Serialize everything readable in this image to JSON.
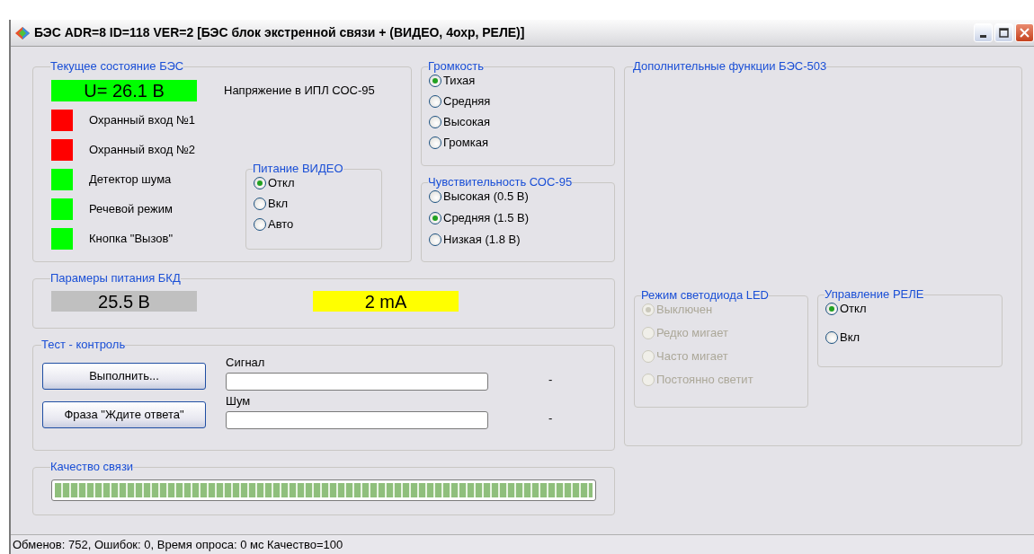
{
  "window": {
    "title": "БЭС ADR=8 ID=118 VER=2 [БЭС блок экстренной связи + (ВИДЕО, 4охр, РЕЛЕ)]"
  },
  "current_state": {
    "title": "Текущее состояние БЭС",
    "voltage": {
      "text": "U= 26.1 В",
      "color": "#00ff00"
    },
    "voltage_label": "Напряжение в ИПЛ СОС-95",
    "indicators": [
      {
        "label": "Охранный вход №1",
        "color": "#ff0000"
      },
      {
        "label": "Охранный вход №2",
        "color": "#ff0000"
      },
      {
        "label": "Детектор шума",
        "color": "#00ff00"
      },
      {
        "label": "Речевой режим",
        "color": "#00ff00"
      },
      {
        "label": "Кнопка \"Вызов\"",
        "color": "#00ff00"
      }
    ]
  },
  "video_power": {
    "title": "Питание ВИДЕО",
    "disabled": false,
    "options": [
      {
        "label": "Откл",
        "selected": true
      },
      {
        "label": "Вкл",
        "selected": false
      },
      {
        "label": "Авто",
        "selected": false
      }
    ]
  },
  "volume": {
    "title": "Громкость",
    "disabled": false,
    "options": [
      {
        "label": "Тихая",
        "selected": true
      },
      {
        "label": "Средняя",
        "selected": false
      },
      {
        "label": "Высокая",
        "selected": false
      },
      {
        "label": "Громкая",
        "selected": false
      }
    ]
  },
  "sensitivity": {
    "title": "Чувствительность СОС-95",
    "disabled": false,
    "options": [
      {
        "label": "Высокая (0.5 В)",
        "selected": false
      },
      {
        "label": "Средняя (1.5 В)",
        "selected": true
      },
      {
        "label": "Низкая (1.8 В)",
        "selected": false
      }
    ]
  },
  "bkd_power": {
    "title": "Парамеры питания БКД",
    "readings": [
      {
        "text": "25.5 В",
        "color": "#c0c0c0"
      },
      {
        "text": "2 mA",
        "color": "#ffff00"
      }
    ]
  },
  "test": {
    "title": "Тест - контроль",
    "buttons": [
      "Выполнить...",
      "Фраза \"Ждите ответа\""
    ],
    "meters": [
      {
        "label": "Сигнал",
        "reading": "-"
      },
      {
        "label": "Шум",
        "reading": "-"
      }
    ]
  },
  "quality": {
    "title": "Качество связи",
    "level": 1
  },
  "extra": {
    "title": "Дополнительные функции БЭС-503",
    "led_mode": {
      "title": "Режим светодиода LED",
      "disabled": true,
      "options": [
        {
          "label": "Выключен",
          "selected": true
        },
        {
          "label": "Редко мигает",
          "selected": false
        },
        {
          "label": "Часто мигает",
          "selected": false
        },
        {
          "label": "Постоянно светит",
          "selected": false
        }
      ]
    },
    "relay": {
      "title": "Управление РЕЛЕ",
      "disabled": false,
      "options": [
        {
          "label": "Откл",
          "selected": true
        },
        {
          "label": "Вкл",
          "selected": false
        }
      ]
    }
  },
  "status_bar": "Обменов: 752, Ошибок: 0, Время опроса: 0 мс Качество=100"
}
